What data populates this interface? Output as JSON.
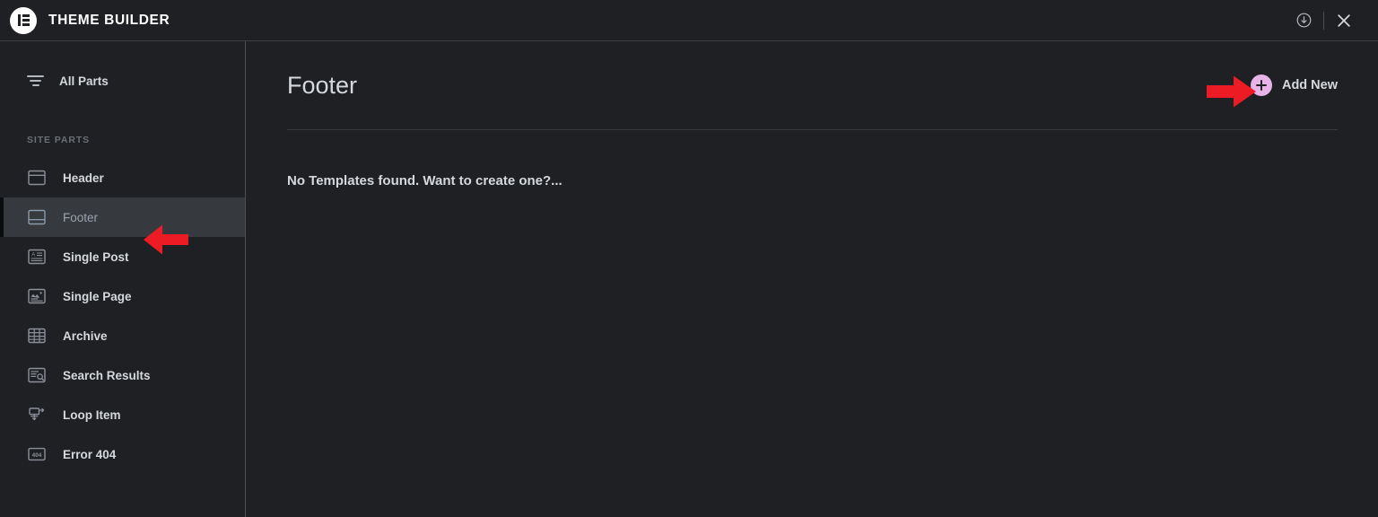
{
  "window": {
    "brand_title": "THEME BUILDER",
    "logo_icon": "elementor-logo-icon",
    "actions": [
      {
        "icon": "download-circle-icon",
        "name": "save-changes-button"
      },
      {
        "icon": "close-icon",
        "name": "close-button"
      }
    ]
  },
  "sidebar": {
    "all_parts": {
      "label": "All Parts",
      "icon": "filter-icon"
    },
    "section_label": "SITE PARTS",
    "items": [
      {
        "label": "Header",
        "icon": "header-layout-icon",
        "active": false
      },
      {
        "label": "Footer",
        "icon": "footer-layout-icon",
        "active": true
      },
      {
        "label": "Single Post",
        "icon": "single-post-icon",
        "active": false
      },
      {
        "label": "Single Page",
        "icon": "single-page-icon",
        "active": false
      },
      {
        "label": "Archive",
        "icon": "archive-grid-icon",
        "active": false
      },
      {
        "label": "Search Results",
        "icon": "search-results-icon",
        "active": false
      },
      {
        "label": "Loop Item",
        "icon": "loop-item-icon",
        "active": false
      },
      {
        "label": "Error 404",
        "icon": "error-404-icon",
        "active": false
      }
    ]
  },
  "main": {
    "page_title": "Footer",
    "add_new_label": "Add New",
    "add_new_icon": "plus-circle-icon",
    "empty_message": "No Templates found. Want to create one?..."
  },
  "annotations": [
    {
      "name": "arrow-pointing-to-add-new",
      "direction": "right",
      "color": "#ed1c24"
    },
    {
      "name": "arrow-pointing-to-footer-item",
      "direction": "left",
      "color": "#ed1c24"
    }
  ],
  "colors": {
    "app_background": "#1e2023",
    "active_item_background": "#36393e",
    "accent_pink": "#e8b4e8",
    "annotation_red": "#ed1c24",
    "text_primary": "#d5d8dc",
    "text_muted": "#6b6f76"
  }
}
